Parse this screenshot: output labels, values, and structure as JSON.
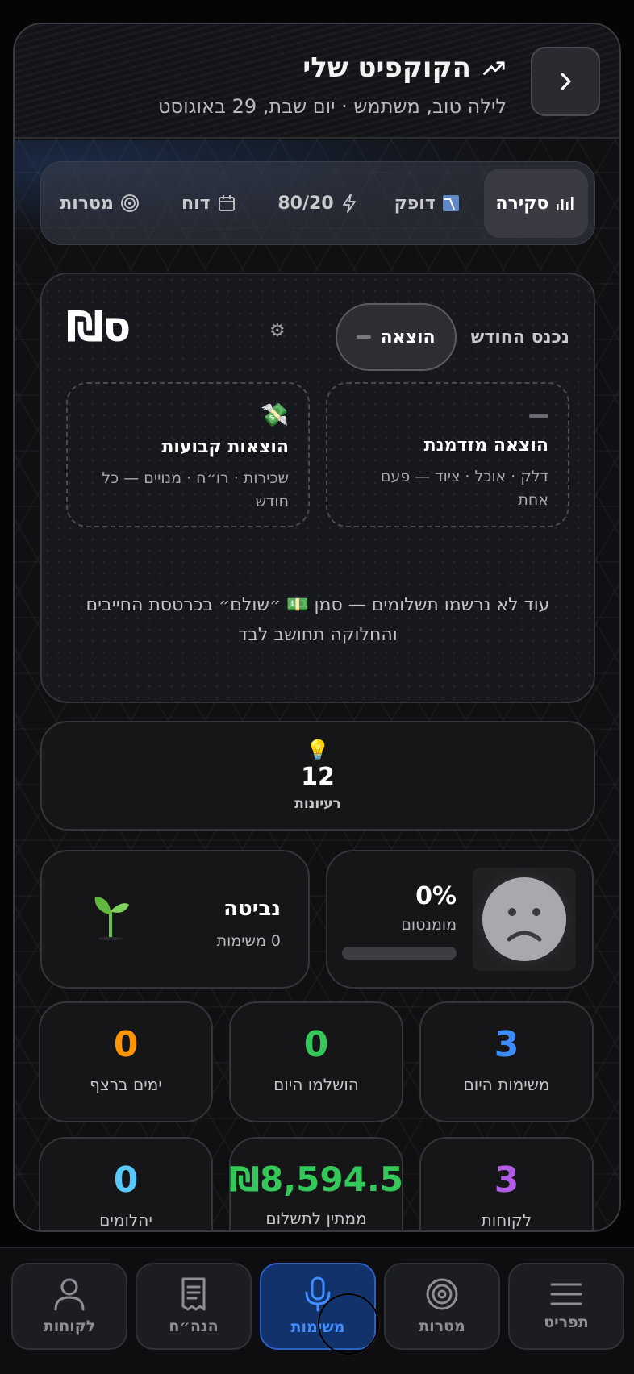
{
  "header": {
    "title": "הקוקפיט שלי",
    "subtitle": "לילה טוב, משתמש · יום שבת, 29 באוגוסט",
    "back_icon": "chevron-right-icon",
    "title_icon": "trending-up-icon"
  },
  "tabs": [
    {
      "label": "סקירה",
      "icon": "bar-chart-icon",
      "active": true
    },
    {
      "label": "דופק",
      "icon": "pulse-chart-icon",
      "active": false
    },
    {
      "label": "80/20",
      "icon": "lightning-icon",
      "active": false
    },
    {
      "label": "דוח",
      "icon": "calendar-icon",
      "active": false
    },
    {
      "label": "מטרות",
      "icon": "target-icon",
      "active": false
    }
  ],
  "budget": {
    "logo": "₪ס",
    "segment_income": "נכנס החודש",
    "segment_expense": "הוצאה",
    "option_one_title": "הוצאה מזדמנת",
    "option_one_sub": "דלק · אוכל · ציוד — פעם אחת",
    "option_two_title": "הוצאות קבועות",
    "option_two_sub": "שכירות · רו״ח · מנויים — כל חודש",
    "note": "עוד לא נרשמו תשלומים — סמן 💵 ״שולם״ בכרטסת החייבים והחלוקה תחושב לבד"
  },
  "ideas": {
    "count": "12",
    "label": "רעיונות"
  },
  "momentum": {
    "value": "0%",
    "label": "מומנטום",
    "level": 0
  },
  "level": {
    "name": "נביטה",
    "tasks": "0 משימות"
  },
  "stats": [
    {
      "value": "3",
      "label": "משימות היום",
      "color": "#3b8cff"
    },
    {
      "value": "0",
      "label": "הושלמו היום",
      "color": "#34c759"
    },
    {
      "value": "0",
      "label": "ימים ברצף",
      "color": "#ff9500"
    },
    {
      "value": "3",
      "label": "לקוחות",
      "color": "#b35ce8"
    },
    {
      "value": "₪8,594.5",
      "label": "ממתין לתשלום",
      "color": "#34c759"
    },
    {
      "value": "0",
      "label": "יהלומים",
      "color": "#5ac8fa"
    }
  ],
  "nav": [
    {
      "label": "תפריט",
      "icon": "menu-icon",
      "active": false
    },
    {
      "label": "מטרות",
      "icon": "target-icon",
      "active": false
    },
    {
      "label": "משימות",
      "icon": "microphone-icon",
      "active": true
    },
    {
      "label": "הנה״ח",
      "icon": "receipt-icon",
      "active": false
    },
    {
      "label": "לקוחות",
      "icon": "user-icon",
      "active": false
    }
  ]
}
